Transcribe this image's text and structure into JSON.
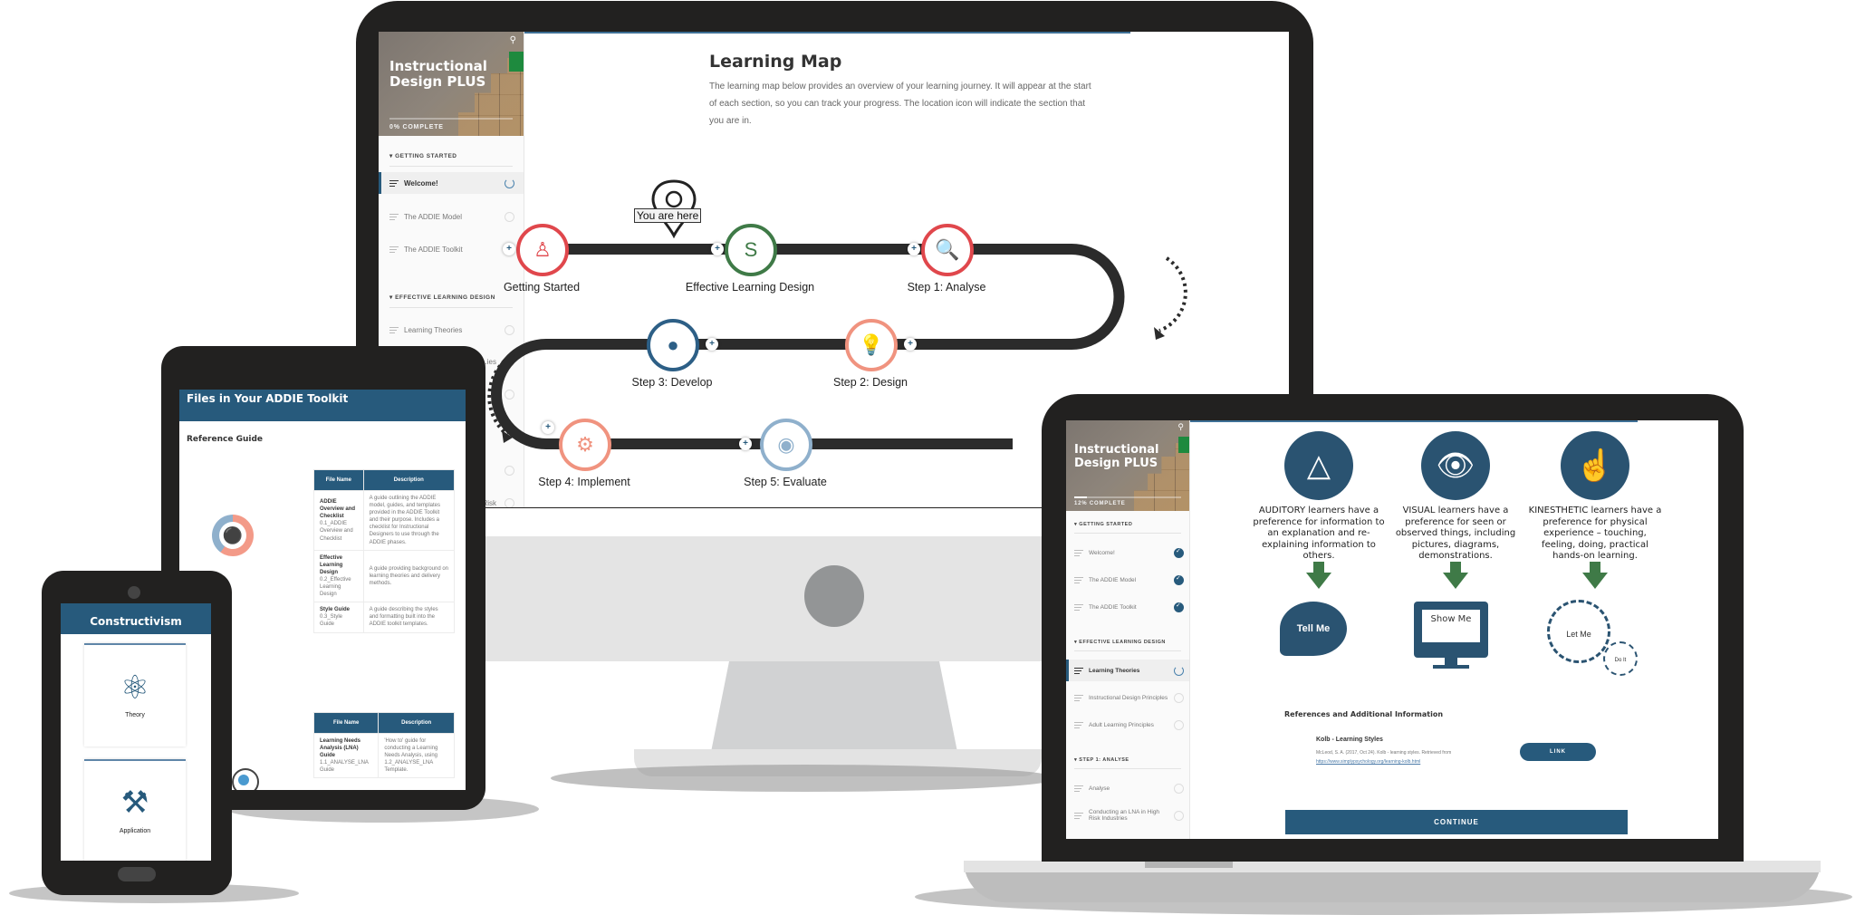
{
  "desktop": {
    "sidebar": {
      "title_line1": "Instructional",
      "title_line2": "Design PLUS",
      "progress_percent": 0,
      "progress_label": "0% COMPLETE",
      "sections": [
        {
          "label": "GETTING STARTED",
          "items": [
            {
              "label": "Welcome!",
              "status": "in-progress"
            },
            {
              "label": "The ADDIE Model",
              "status": "not-started"
            },
            {
              "label": "The ADDIE Toolkit",
              "status": "not-started"
            }
          ]
        },
        {
          "label": "EFFECTIVE LEARNING DESIGN",
          "items": [
            {
              "label": "Learning Theories",
              "status": "not-started"
            },
            {
              "label": "…ies",
              "status": "not-started"
            },
            {
              "label": "",
              "status": "not-started"
            }
          ]
        },
        {
          "label": "",
          "items": [
            {
              "label": "",
              "status": "not-started"
            },
            {
              "label": "…Risk",
              "status": "not-started"
            }
          ]
        }
      ]
    },
    "main": {
      "title": "Learning Map",
      "description": "The learning map below provides an overview of your learning journey. It will appear at the start of each section, so you can track your progress. The location icon will indicate the section that you are in.",
      "you_are_here": "You are here",
      "nodes": [
        {
          "label": "Getting Started",
          "color": "#e0474c",
          "icon": "presenter-icon"
        },
        {
          "label": "Effective Learning Design",
          "color": "#3f7a47",
          "icon": "whiteboard-icon"
        },
        {
          "label": "Step 1: Analyse",
          "color": "#e0474c",
          "icon": "speech-search-icon"
        },
        {
          "label": "Step 2: Design",
          "color": "#f0937f",
          "icon": "lightbulb-icon"
        },
        {
          "label": "Step 3: Develop",
          "color": "#2d5f86",
          "icon": "venn-icon"
        },
        {
          "label": "Step 4: Implement",
          "color": "#f0937f",
          "icon": "idea-gear-cycle-icon"
        },
        {
          "label": "Step 5: Evaluate",
          "color": "#8fb0cc",
          "icon": "binoculars-icon"
        }
      ]
    }
  },
  "tablet": {
    "header": "Files in Your ADDIE Toolkit",
    "subheading": "Reference Guide",
    "table_headers": [
      "File Name",
      "Description"
    ],
    "table1": [
      {
        "name": "ADDIE Overview and Checklist",
        "file": "0.1_ADDIE Overview and Checklist",
        "desc": "A guide outlining the ADDIE model, guides, and templates provided in the ADDIE Toolkit and their purpose. Includes a checklist for Instructional Designers to use through the ADDIE phases."
      },
      {
        "name": "Effective Learning Design",
        "file": "0.2_Effective Learning Design",
        "desc": "A guide providing background on learning theories and delivery methods."
      },
      {
        "name": "Style Guide",
        "file": "0.3_Style Guide",
        "desc": "A guide describing the styles and formatting built into the ADDIE toolkit templates."
      }
    ],
    "table2": [
      {
        "name": "Learning Needs Analysis (LNA) Guide",
        "file": "1.1_ANALYSE_LNA Guide",
        "desc": "'How to' guide for conducting a Learning Needs Analysis, using 1.2_ANALYSE_LNA Template."
      }
    ]
  },
  "phone": {
    "header": "Constructivism",
    "cards": [
      {
        "label": "Theory",
        "icon": "atom-icon"
      },
      {
        "label": "Application",
        "icon": "tools-icon"
      }
    ]
  },
  "laptop": {
    "sidebar": {
      "title_line1": "Instructional",
      "title_line2": "Design PLUS",
      "progress_percent": 12,
      "progress_label": "12% COMPLETE",
      "sections": [
        {
          "label": "GETTING STARTED",
          "items": [
            {
              "label": "Welcome!",
              "status": "complete"
            },
            {
              "label": "The ADDIE Model",
              "status": "complete"
            },
            {
              "label": "The ADDIE Toolkit",
              "status": "complete"
            }
          ]
        },
        {
          "label": "EFFECTIVE LEARNING DESIGN",
          "items": [
            {
              "label": "Learning Theories",
              "status": "in-progress"
            },
            {
              "label": "Instructional Design Principles",
              "status": "not-started"
            },
            {
              "label": "Adult Learning Principles",
              "status": "not-started"
            }
          ]
        },
        {
          "label": "STEP 1: ANALYSE",
          "items": [
            {
              "label": "Analyse",
              "status": "not-started"
            },
            {
              "label": "Conducting an LNA in High Risk Industries",
              "status": "not-started"
            }
          ]
        }
      ]
    },
    "main": {
      "styles": [
        {
          "text": "AUDITORY learners have a preference for information to an explanation and re-explaining information to others.",
          "icon": "ear-icon",
          "result": "Tell Me",
          "result_icon": "speech-bubbles-icon"
        },
        {
          "text": "VISUAL learners have a preference for seen or observed things, including pictures, diagrams, demonstrations.",
          "icon": "eye-icon",
          "result": "Show Me",
          "result_icon": "monitor-icon"
        },
        {
          "text": "KINESTHETIC learners have a preference for physical experience – touching, feeling, doing, practical hands-on learning.",
          "icon": "pointing-hand-icon",
          "result_gear1": "Let Me",
          "result_gear2": "Do It",
          "result_icon": "gears-icon"
        }
      ],
      "references_heading": "References and Additional Information",
      "reference": {
        "title": "Kolb - Learning Styles",
        "citation": "McLeod, S. A. (2017, Oct 24). Kolb - learning styles. Retrieved from",
        "url": "https://www.simplypsychology.org/learning-kolb.html",
        "link_label": "LINK"
      },
      "continue_label": "CONTINUE"
    }
  },
  "colors": {
    "brand": "#275a7c",
    "bezel": "#222120",
    "green_arrow": "#3f7a47"
  }
}
